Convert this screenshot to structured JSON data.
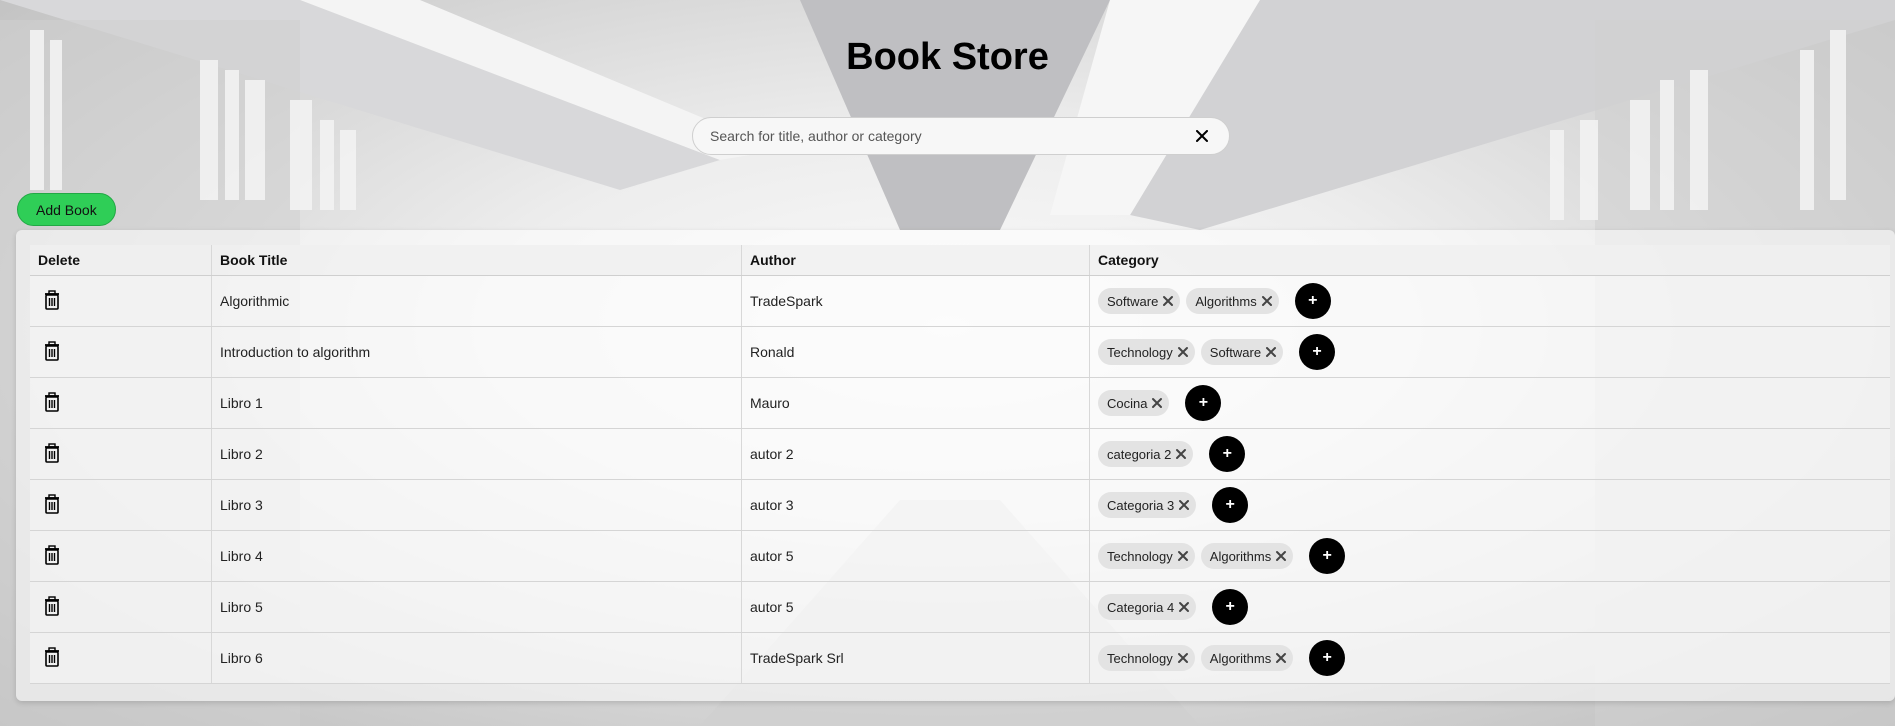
{
  "page": {
    "title": "Book Store"
  },
  "search": {
    "placeholder": "Search for title, author or category",
    "value": ""
  },
  "toolbar": {
    "add_book_label": "Add Book"
  },
  "table": {
    "headers": [
      "Delete",
      "Book Title",
      "Author",
      "Category"
    ],
    "add_category_label": "+",
    "rows": [
      {
        "title": "Algorithmic",
        "author": "TradeSpark",
        "categories": [
          "Software",
          "Algorithms"
        ]
      },
      {
        "title": "Introduction to algorithm",
        "author": "Ronald",
        "categories": [
          "Technology",
          "Software"
        ]
      },
      {
        "title": "Libro 1",
        "author": "Mauro",
        "categories": [
          "Cocina"
        ]
      },
      {
        "title": "Libro 2",
        "author": "autor 2",
        "categories": [
          "categoria 2"
        ]
      },
      {
        "title": "Libro 3",
        "author": "autor 3",
        "categories": [
          "Categoria 3"
        ]
      },
      {
        "title": "Libro 4",
        "author": "autor 5",
        "categories": [
          "Technology",
          "Algorithms"
        ]
      },
      {
        "title": "Libro 5",
        "author": "autor 5",
        "categories": [
          "Categoria 4"
        ]
      },
      {
        "title": "Libro 6",
        "author": "TradeSpark Srl",
        "categories": [
          "Technology",
          "Algorithms"
        ]
      }
    ]
  },
  "icons": {
    "clear": "close-icon",
    "delete": "trash-icon",
    "chip_remove": "close-icon",
    "add_category": "plus-icon"
  },
  "colors": {
    "add_button": "#2fce57",
    "chip_bg": "#e3e3e3",
    "add_category_bg": "#000000"
  }
}
